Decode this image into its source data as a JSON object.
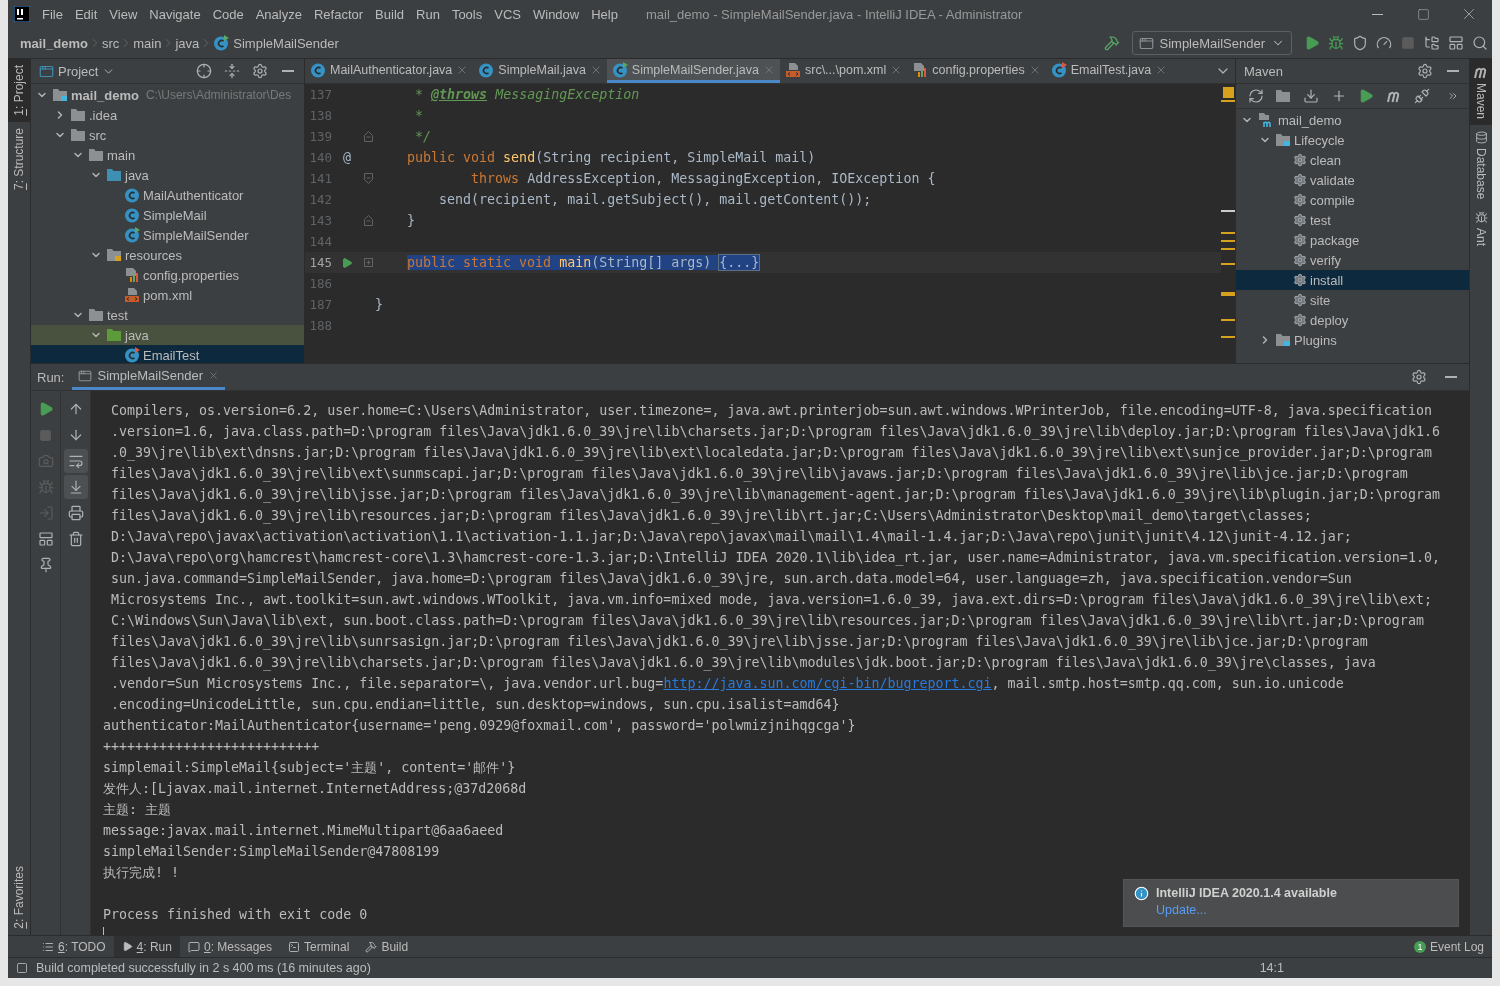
{
  "window": {
    "title": "mail_demo - SimpleMailSender.java - IntelliJ IDEA - Administrator"
  },
  "menu": [
    "File",
    "Edit",
    "View",
    "Navigate",
    "Code",
    "Analyze",
    "Refactor",
    "Build",
    "Run",
    "Tools",
    "VCS",
    "Window",
    "Help"
  ],
  "breadcrumbs": [
    {
      "label": "mail_demo"
    },
    {
      "label": "src"
    },
    {
      "label": "main"
    },
    {
      "label": "java"
    },
    {
      "label": "SimpleMailSender",
      "kind": "class-main"
    }
  ],
  "run_config": {
    "label": "SimpleMailSender"
  },
  "left_tool_windows": [
    {
      "mnemonic": "1",
      "label": ": Project",
      "selected": true
    },
    {
      "mnemonic": "7",
      "label": ": Structure",
      "selected": false
    }
  ],
  "left_tool_windows_bottom": [
    {
      "mnemonic": "2",
      "label": ": Favorites",
      "selected": false
    }
  ],
  "project_panel": {
    "title": "Project",
    "tree": [
      {
        "label": "mail_demo",
        "path": "C:\\Users\\Administrator\\Des",
        "kind": "module",
        "expanded": true,
        "selected": false,
        "tinted": false,
        "children": [
          {
            "label": ".idea",
            "kind": "folder",
            "expanded": false,
            "selected": false,
            "tinted": false
          },
          {
            "label": "src",
            "kind": "folder",
            "expanded": true,
            "selected": false,
            "tinted": false,
            "children": [
              {
                "label": "main",
                "kind": "folder",
                "expanded": true,
                "selected": false,
                "tinted": false,
                "children": [
                  {
                    "label": "java",
                    "kind": "source-folder",
                    "expanded": true,
                    "selected": false,
                    "tinted": false,
                    "children": [
                      {
                        "label": "MailAuthenticator",
                        "kind": "class",
                        "selected": false,
                        "tinted": false
                      },
                      {
                        "label": "SimpleMail",
                        "kind": "class",
                        "selected": false,
                        "tinted": false
                      },
                      {
                        "label": "SimpleMailSender",
                        "kind": "class-main",
                        "selected": false,
                        "tinted": false
                      }
                    ]
                  },
                  {
                    "label": "resources",
                    "kind": "resources-folder",
                    "expanded": true,
                    "selected": false,
                    "tinted": false,
                    "children": [
                      {
                        "label": "config.properties",
                        "kind": "properties",
                        "selected": false,
                        "tinted": false
                      },
                      {
                        "label": "pom.xml",
                        "kind": "xml",
                        "selected": false,
                        "tinted": false
                      }
                    ]
                  }
                ]
              },
              {
                "label": "test",
                "kind": "folder",
                "expanded": true,
                "selected": false,
                "tinted": false,
                "children": [
                  {
                    "label": "java",
                    "kind": "test-folder",
                    "expanded": true,
                    "selected": false,
                    "tinted": true,
                    "children": [
                      {
                        "label": "EmailTest",
                        "kind": "test-class",
                        "selected": true
                      }
                    ]
                  }
                ]
              }
            ]
          }
        ]
      }
    ]
  },
  "editor": {
    "tabs": [
      {
        "label": "MailAuthenticator.java",
        "kind": "class",
        "selected": false
      },
      {
        "label": "SimpleMail.java",
        "kind": "class",
        "selected": false
      },
      {
        "label": "SimpleMailSender.java",
        "kind": "class-main",
        "selected": true
      },
      {
        "label": "src\\...\\pom.xml",
        "kind": "xml",
        "selected": false
      },
      {
        "label": "config.properties",
        "kind": "properties",
        "selected": false
      },
      {
        "label": "EmailTest.java",
        "kind": "test-class",
        "selected": false
      }
    ],
    "lines": [
      {
        "number": "137",
        "tokens": [
          {
            "text": "     *",
            "kind": "comment"
          },
          {
            "text": " @throws",
            "kind": "doc-tag"
          },
          {
            "text": " MessagingException",
            "kind": "comment"
          }
        ]
      },
      {
        "number": "138",
        "tokens": [
          {
            "text": "     *",
            "kind": "comment"
          }
        ]
      },
      {
        "number": "139",
        "fold_end": true,
        "tokens": [
          {
            "text": "     */",
            "kind": "comment"
          }
        ]
      },
      {
        "number": "140",
        "gutter": "@",
        "tokens": [
          {
            "text": "    public void ",
            "kind": "keyword"
          },
          {
            "text": "send",
            "kind": "method"
          },
          {
            "text": "(String recipient, SimpleMail mail)"
          }
        ]
      },
      {
        "number": "141",
        "fold_start": true,
        "tokens": [
          {
            "text": "            throws ",
            "kind": "keyword"
          },
          {
            "text": "AddressException, MessagingException, IOException {"
          }
        ]
      },
      {
        "number": "142",
        "tokens": [
          {
            "text": "        send(recipient, mail.getSubject(), mail.getContent());"
          }
        ]
      },
      {
        "number": "143",
        "fold_end": true,
        "tokens": [
          {
            "text": "    }"
          }
        ]
      },
      {
        "number": "144"
      },
      {
        "number": "145",
        "current": true,
        "run": true,
        "folded": true,
        "tokens": [
          {
            "text": "    public static void ",
            "kind": "keyword",
            "selected": true
          },
          {
            "text": "main",
            "kind": "method",
            "selected": true
          },
          {
            "text": "(String[] args) ",
            "selected": true
          },
          {
            "text": "{...}",
            "kind": "folded",
            "selected": true
          }
        ]
      },
      {
        "number": "186"
      },
      {
        "number": "187",
        "tokens": [
          {
            "text": "}"
          }
        ]
      },
      {
        "number": "188"
      }
    ]
  },
  "maven_panel": {
    "title": "Maven",
    "tree": [
      {
        "label": "mail_demo",
        "kind": "maven-project",
        "expanded": true,
        "selected": false,
        "children": [
          {
            "label": "Lifecycle",
            "kind": "maven-folder",
            "expanded": true,
            "selected": false,
            "children": [
              {
                "label": "clean",
                "kind": "goal",
                "selected": false
              },
              {
                "label": "validate",
                "kind": "goal",
                "selected": false
              },
              {
                "label": "compile",
                "kind": "goal",
                "selected": false
              },
              {
                "label": "test",
                "kind": "goal",
                "selected": false
              },
              {
                "label": "package",
                "kind": "goal",
                "selected": false
              },
              {
                "label": "verify",
                "kind": "goal",
                "selected": false
              },
              {
                "label": "install",
                "kind": "goal",
                "selected": true
              },
              {
                "label": "site",
                "kind": "goal",
                "selected": false
              },
              {
                "label": "deploy",
                "kind": "goal",
                "selected": false
              }
            ]
          },
          {
            "label": "Plugins",
            "kind": "maven-folder",
            "expanded": false,
            "selected": false
          }
        ]
      }
    ]
  },
  "right_tool_windows": [
    {
      "label": "Maven",
      "selected": true
    },
    {
      "label": "Database",
      "selected": false
    },
    {
      "label": "Ant",
      "selected": false
    }
  ],
  "run_panel": {
    "label": "Run:",
    "tab": "SimpleMailSender",
    "soft_wrap_on": true,
    "scroll_to_end_on": true,
    "console": {
      "wrapped_message": [
        "Compilers, os.version=6.2, user.home=C:\\Users\\Administrator, user.timezone=, java.awt.printerjob=sun.awt.windows.WPrinterJob, file.encoding=UTF-8, java.specification",
        ".version=1.6, java.class.path=D:\\program files\\Java\\jdk1.6.0_39\\jre\\lib\\charsets.jar;D:\\program files\\Java\\jdk1.6.0_39\\jre\\lib\\deploy.jar;D:\\program files\\Java\\jdk1.6",
        ".0_39\\jre\\lib\\ext\\dnsns.jar;D:\\program files\\Java\\jdk1.6.0_39\\jre\\lib\\ext\\localedata.jar;D:\\program files\\Java\\jdk1.6.0_39\\jre\\lib\\ext\\sunjce_provider.jar;D:\\program",
        "files\\Java\\jdk1.6.0_39\\jre\\lib\\ext\\sunmscapi.jar;D:\\program files\\Java\\jdk1.6.0_39\\jre\\lib\\javaws.jar;D:\\program files\\Java\\jdk1.6.0_39\\jre\\lib\\jce.jar;D:\\program",
        "files\\Java\\jdk1.6.0_39\\jre\\lib\\jsse.jar;D:\\program files\\Java\\jdk1.6.0_39\\jre\\lib\\management-agent.jar;D:\\program files\\Java\\jdk1.6.0_39\\jre\\lib\\plugin.jar;D:\\program",
        "files\\Java\\jdk1.6.0_39\\jre\\lib\\resources.jar;D:\\program files\\Java\\jdk1.6.0_39\\jre\\lib\\rt.jar;C:\\Users\\Administrator\\Desktop\\mail_demo\\target\\classes;",
        "D:\\Java\\repo\\javax\\activation\\activation\\1.1\\activation-1.1.jar;D:\\Java\\repo\\javax\\mail\\mail\\1.4\\mail-1.4.jar;D:\\Java\\repo\\junit\\junit\\4.12\\junit-4.12.jar;",
        "D:\\Java\\repo\\org\\hamcrest\\hamcrest-core\\1.3\\hamcrest-core-1.3.jar;D:\\IntelliJ IDEA 2020.1\\lib\\idea_rt.jar, user.name=Administrator, java.vm.specification.version=1.0,",
        "sun.java.command=SimpleMailSender, java.home=D:\\program files\\Java\\jdk1.6.0_39\\jre, sun.arch.data.model=64, user.language=zh, java.specification.vendor=Sun",
        "Microsystems Inc., awt.toolkit=sun.awt.windows.WToolkit, java.vm.info=mixed mode, java.version=1.6.0_39, java.ext.dirs=D:\\program files\\Java\\jdk1.6.0_39\\jre\\lib\\ext;",
        "C:\\Windows\\Sun\\Java\\lib\\ext, sun.boot.class.path=D:\\program files\\Java\\jdk1.6.0_39\\jre\\lib\\resources.jar;D:\\program files\\Java\\jdk1.6.0_39\\jre\\lib\\rt.jar;D:\\program",
        "files\\Java\\jdk1.6.0_39\\jre\\lib\\sunrsasign.jar;D:\\program files\\Java\\jdk1.6.0_39\\jre\\lib\\jsse.jar;D:\\program files\\Java\\jdk1.6.0_39\\jre\\lib\\jce.jar;D:\\program",
        "files\\Java\\jdk1.6.0_39\\jre\\lib\\charsets.jar;D:\\program files\\Java\\jdk1.6.0_39\\jre\\lib\\modules\\jdk.boot.jar;D:\\program files\\Java\\jdk1.6.0_39\\jre\\classes, java",
        {
          "text": ".vendor=Sun Microsystems Inc., file.separator=\\, java.vendor.url.bug=",
          "link": "http://java.sun.com/cgi-bin/bugreport.cgi",
          "after": ", mail.smtp.host=smtp.qq.com, sun.io.unicode"
        },
        ".encoding=UnicodeLittle, sun.cpu.endian=little, sun.desktop=windows, sun.cpu.isalist=amd64}"
      ],
      "output": [
        "authenticator:MailAuthenticator{username='peng.0929@foxmail.com', password='polwmizjnihqgcga'}",
        "+++++++++++++++++++++++++++",
        "simplemail:SimpleMail{subject='主题', content='邮件'}",
        "发件人:[Ljavax.mail.internet.InternetAddress;@37d2068d",
        "主题: 主题",
        "message:javax.mail.internet.MimeMultipart@6aa6aeed",
        "simpleMailSender:SimpleMailSender@47808199",
        "执行完成! !"
      ],
      "exit_message": "Process finished with exit code 0"
    }
  },
  "notification": {
    "title": "IntelliJ IDEA 2020.1.4 available",
    "link": "Update..."
  },
  "tool_tabs": [
    {
      "kind": "todo",
      "mnemonic": "6",
      "label": ": TODO",
      "selected": false
    },
    {
      "kind": "run",
      "mnemonic": "4",
      "label": ": Run",
      "selected": true
    },
    {
      "kind": "messages",
      "mnemonic": "0",
      "label": ": Messages",
      "selected": false
    },
    {
      "kind": "terminal",
      "label": "Terminal",
      "selected": false
    },
    {
      "kind": "build",
      "label": "Build",
      "selected": false
    }
  ],
  "event_log": {
    "badge": "1",
    "label": "Event Log"
  },
  "status_bar": {
    "message": "Build completed successfully in 2 s 400 ms (16 minutes ago)",
    "position": "14:1"
  }
}
